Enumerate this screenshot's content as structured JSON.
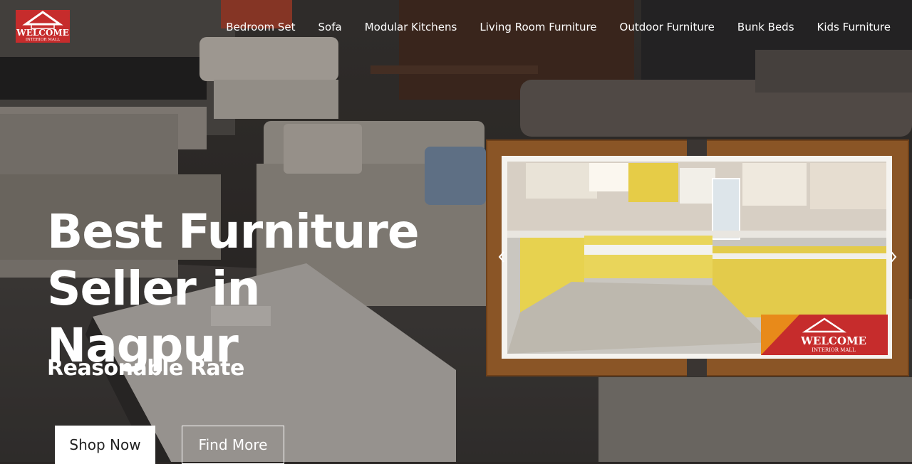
{
  "brand": {
    "logo_text_top": "WELCOME",
    "logo_text_bottom": "INTERIOR MALL"
  },
  "nav": {
    "items": [
      {
        "label": "Bedroom Set"
      },
      {
        "label": "Sofa"
      },
      {
        "label": "Modular Kitchens"
      },
      {
        "label": "Living Room Furniture"
      },
      {
        "label": "Outdoor Furniture"
      },
      {
        "label": "Bunk Beds"
      },
      {
        "label": "Kids Furniture"
      }
    ]
  },
  "hero": {
    "title": "Best Furniture Seller in Nagpur",
    "subtitle": "Reasonable Rate",
    "primary_button": "Shop Now",
    "secondary_button": "Find More"
  },
  "slider": {
    "badge_top": "WELCOME",
    "badge_bottom": "INTERIOR MALL"
  },
  "colors": {
    "brand_red": "#c62c2c",
    "kitchen_yellow": "#e8d25a",
    "wood": "#8a5526"
  }
}
